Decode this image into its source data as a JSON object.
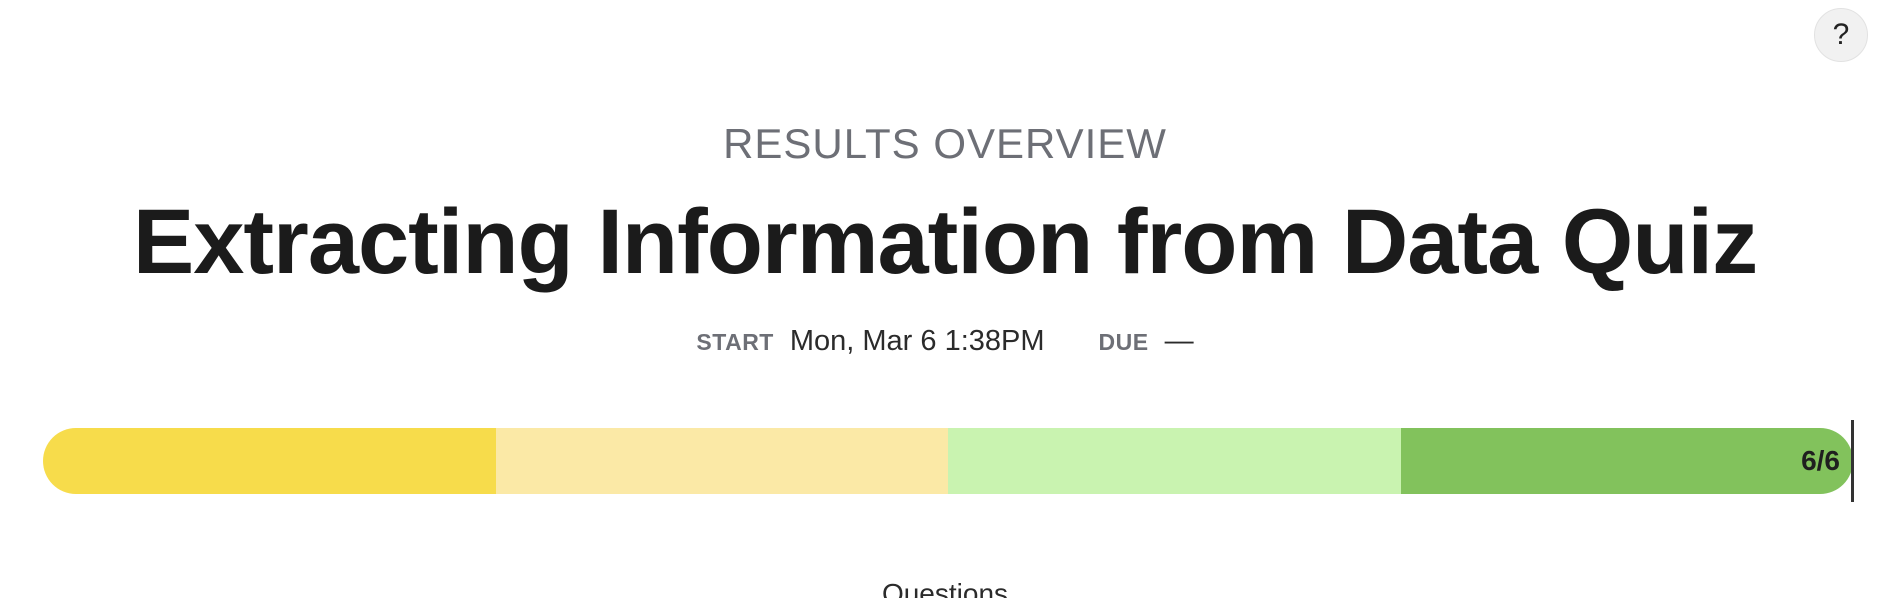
{
  "help": {
    "label": "?"
  },
  "header": {
    "eyebrow": "RESULTS OVERVIEW",
    "title": "Extracting Information from Data Quiz"
  },
  "meta": {
    "start_label": "START",
    "start_value": "Mon, Mar 6 1:38PM",
    "due_label": "DUE",
    "due_value": "—"
  },
  "progress": {
    "label": "6/6",
    "completed": 6,
    "total": 6,
    "segments": [
      {
        "color": "#f7dc4b",
        "fraction": 0.25
      },
      {
        "color": "#fbe9a6",
        "fraction": 0.25
      },
      {
        "color": "#c9f3b0",
        "fraction": 0.25
      },
      {
        "color": "#82c25c",
        "fraction": 0.25
      }
    ]
  },
  "section": {
    "heading": "Questions"
  }
}
